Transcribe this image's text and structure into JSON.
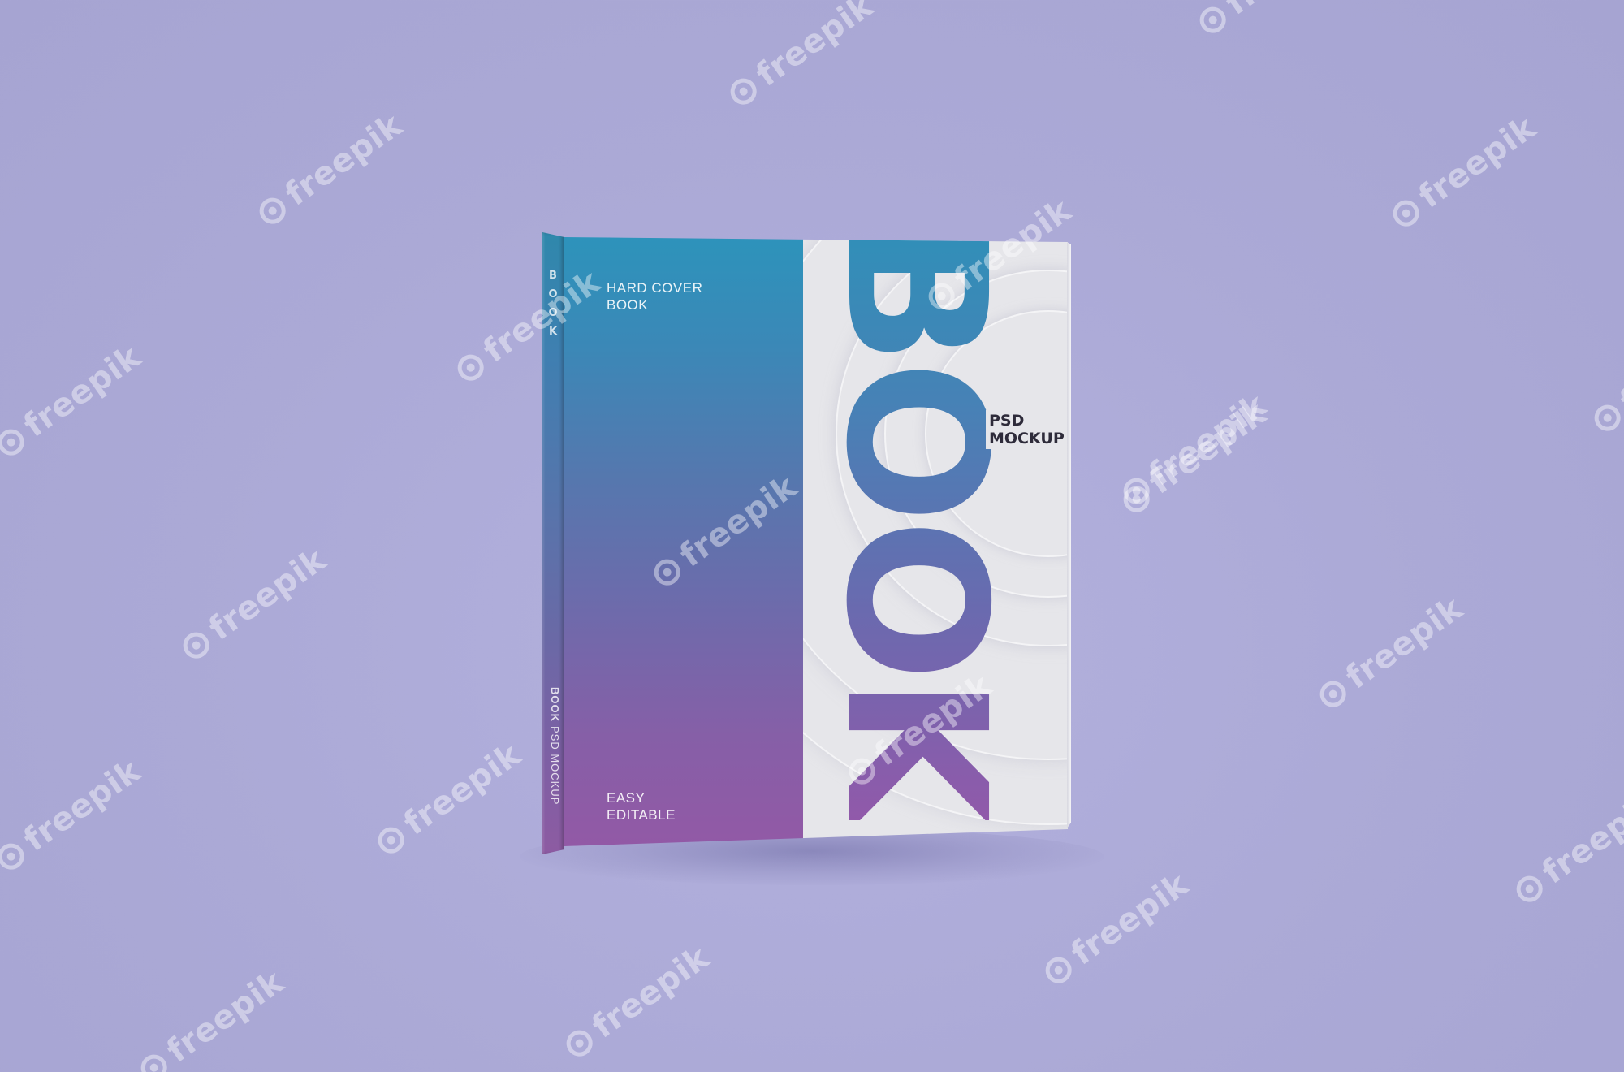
{
  "scene": {
    "background_color": "#aba9d6",
    "subject": "hardcover book mockup"
  },
  "book": {
    "spine_top_letters": [
      "B",
      "O",
      "O",
      "K"
    ],
    "spine_bottom_bold": "BOOK",
    "spine_bottom_rest": "PSD MOCKUP",
    "cover_top_line1": "HARD COVER",
    "cover_top_line2": "BOOK",
    "cover_bottom_line1": "EASY",
    "cover_bottom_line2": "EDITABLE",
    "big_title": "BOOK",
    "badge_line1": "PSD",
    "badge_line2": "MOCKUP",
    "gradient_top_color": "#2d93bb",
    "gradient_bottom_color": "#9259a6",
    "white_panel_color": "#e6e6ea"
  },
  "watermark": {
    "text": "freepik",
    "icon": "freepik-logo-icon"
  }
}
